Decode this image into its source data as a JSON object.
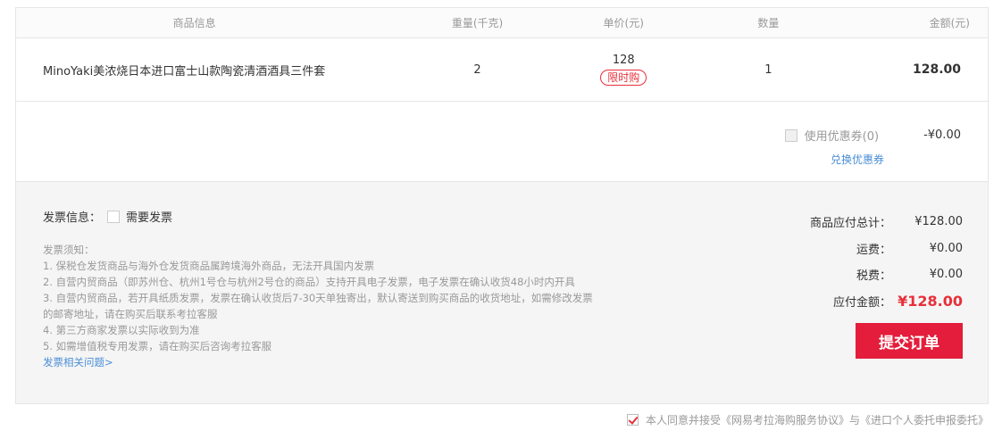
{
  "table": {
    "headers": {
      "info": "商品信息",
      "weight": "重量(千克)",
      "price": "单价(元)",
      "qty": "数量",
      "amount": "金额(元)"
    },
    "row": {
      "name": "MinoYaki美浓烧日本进口富士山款陶瓷清酒酒具三件套",
      "weight": "2",
      "price": "128",
      "tag": "限时购",
      "qty": "1",
      "amount": "128.00"
    }
  },
  "coupon": {
    "label": "使用优惠券(0)",
    "value": "-¥0.00",
    "switch_label": "兑换优惠券"
  },
  "invoice": {
    "title": "发票信息：",
    "need_label": "需要发票",
    "notes_title": "发票须知：",
    "notes": [
      "1. 保税仓发货商品与海外仓发货商品属跨境海外商品，无法开具国内发票",
      "2. 自营内贸商品（即苏州仓、杭州1号仓与杭州2号仓的商品）支持开具电子发票，电子发票在确认收货48小时内开具",
      "3. 自营内贸商品，若开具纸质发票，发票在确认收货后7-30天单独寄出，默认寄送到购买商品的收货地址，如需修改发票",
      "的邮寄地址，请在购买后联系考拉客服",
      "4. 第三方商家发票以实际收到为准",
      "5. 如需增值税专用发票，请在购买后咨询考拉客服"
    ],
    "help_link": "发票相关问题>"
  },
  "totals": {
    "goods_label": "商品应付总计：",
    "goods_value": "¥128.00",
    "shipping_label": "运费：",
    "shipping_value": "¥0.00",
    "tax_label": "税费：",
    "tax_value": "¥0.00",
    "due_label": "应付金额：",
    "due_value": "¥128.00"
  },
  "submit_label": "提交订单",
  "agreement": "本人同意并接受《网易考拉海购服务协议》与《进口个人委托申报委托》",
  "colors": {
    "accent": "#e31d3b",
    "link": "#4a8fd6"
  }
}
